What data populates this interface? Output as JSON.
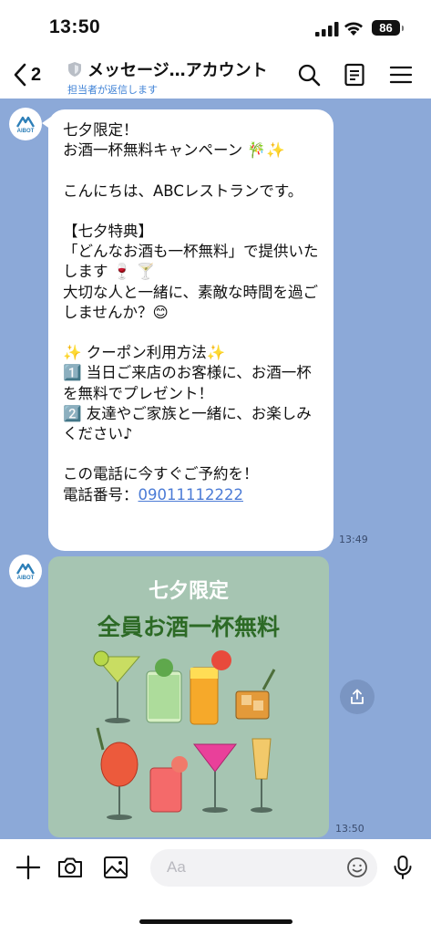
{
  "status_bar": {
    "time": "13:50",
    "battery": "86"
  },
  "header": {
    "back_count": "2",
    "title": "メッセージ…アカウント",
    "subtitle": "担当者が返信します"
  },
  "avatar": {
    "label": "AIBOT"
  },
  "messages": {
    "text_message": "七夕限定！\nお酒一杯無料キャンペーン 🎋✨\n\nこんにちは、ABCレストランです。\n\n【七夕特典】\n「どんなお酒も一杯無料」で提供いたします 🍷 🍸\n大切な人と一緒に、素敵な時間を過ごしませんか？😊\n\n✨ クーポン利用方法✨\n1️⃣ 当日ご来店のお客様に、お酒一杯を無料でプレゼント！\n2️⃣ 友達やご家族と一緒に、お楽しみください♪\n\nこの電話に今すぐご予約を！",
    "phone_label": "電話番号：",
    "phone_number": "09011112222",
    "text_time": "13:49",
    "image_title": "七夕限定",
    "image_main": "全員お酒一杯無料",
    "image_time": "13:50"
  },
  "input": {
    "placeholder": "Aa"
  },
  "icons": {
    "back": "chevron-left-icon",
    "search": "search-icon",
    "notes": "notes-icon",
    "menu": "menu-icon",
    "plus": "plus-icon",
    "camera": "camera-icon",
    "image": "image-icon",
    "emoji": "emoji-icon",
    "mic": "microphone-icon",
    "share": "share-icon"
  },
  "colors": {
    "chat_background": "#8ca9d8",
    "link": "#4b7bd6",
    "subtitle": "#3f82d6",
    "image_background": "#a6c5b2",
    "image_title": "#ffffff",
    "image_main_text": "#2d6a26"
  }
}
